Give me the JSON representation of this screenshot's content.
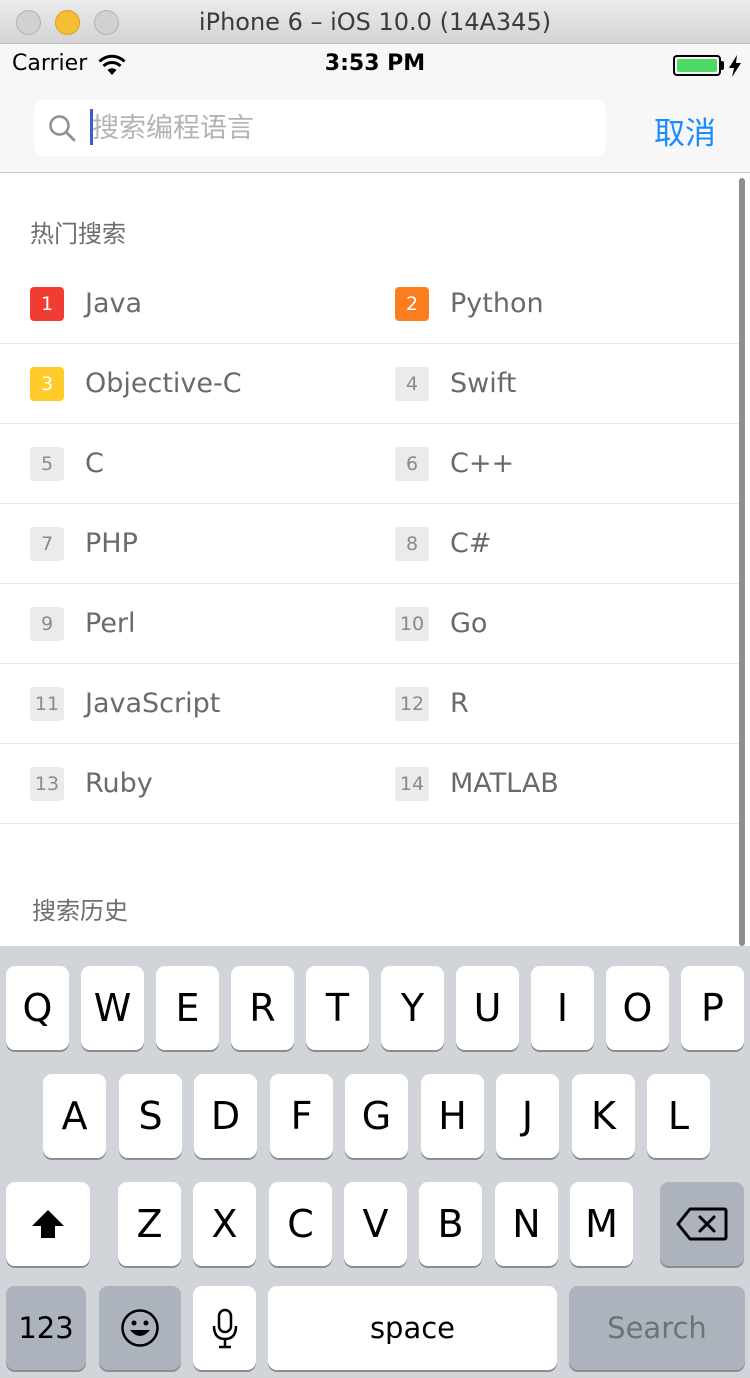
{
  "window": {
    "title": "iPhone 6 – iOS 10.0 (14A345)"
  },
  "status_bar": {
    "carrier": "Carrier",
    "time": "3:53 PM",
    "battery_color": "#4cd964"
  },
  "search": {
    "placeholder": "搜索编程语言",
    "value": "",
    "cancel_label": "取消"
  },
  "hot": {
    "title": "热门搜索",
    "rows": [
      [
        {
          "rank": "1",
          "name": "Java"
        },
        {
          "rank": "2",
          "name": "Python"
        }
      ],
      [
        {
          "rank": "3",
          "name": "Objective-C"
        },
        {
          "rank": "4",
          "name": "Swift"
        }
      ],
      [
        {
          "rank": "5",
          "name": "C"
        },
        {
          "rank": "6",
          "name": "C++"
        }
      ],
      [
        {
          "rank": "7",
          "name": "PHP"
        },
        {
          "rank": "8",
          "name": "C#"
        }
      ],
      [
        {
          "rank": "9",
          "name": "Perl"
        },
        {
          "rank": "10",
          "name": "Go"
        }
      ],
      [
        {
          "rank": "11",
          "name": "JavaScript"
        },
        {
          "rank": "12",
          "name": "R"
        }
      ],
      [
        {
          "rank": "13",
          "name": "Ruby"
        },
        {
          "rank": "14",
          "name": "MATLAB"
        }
      ]
    ],
    "rank_colors": {
      "1": "#f03c33",
      "2": "#fa7d1e",
      "3": "#fecb2a",
      "default": "#ebebeb"
    }
  },
  "history": {
    "title": "搜索历史"
  },
  "keyboard": {
    "row1": [
      "Q",
      "W",
      "E",
      "R",
      "T",
      "Y",
      "U",
      "I",
      "O",
      "P"
    ],
    "row2": [
      "A",
      "S",
      "D",
      "F",
      "G",
      "H",
      "J",
      "K",
      "L"
    ],
    "row3": [
      "Z",
      "X",
      "C",
      "V",
      "B",
      "N",
      "M"
    ],
    "numbers_label": "123",
    "space_label": "space",
    "search_label": "Search",
    "icons": {
      "shift": "shift-icon",
      "delete": "delete-icon",
      "emoji": "emoji-icon",
      "mic": "microphone-icon"
    }
  }
}
